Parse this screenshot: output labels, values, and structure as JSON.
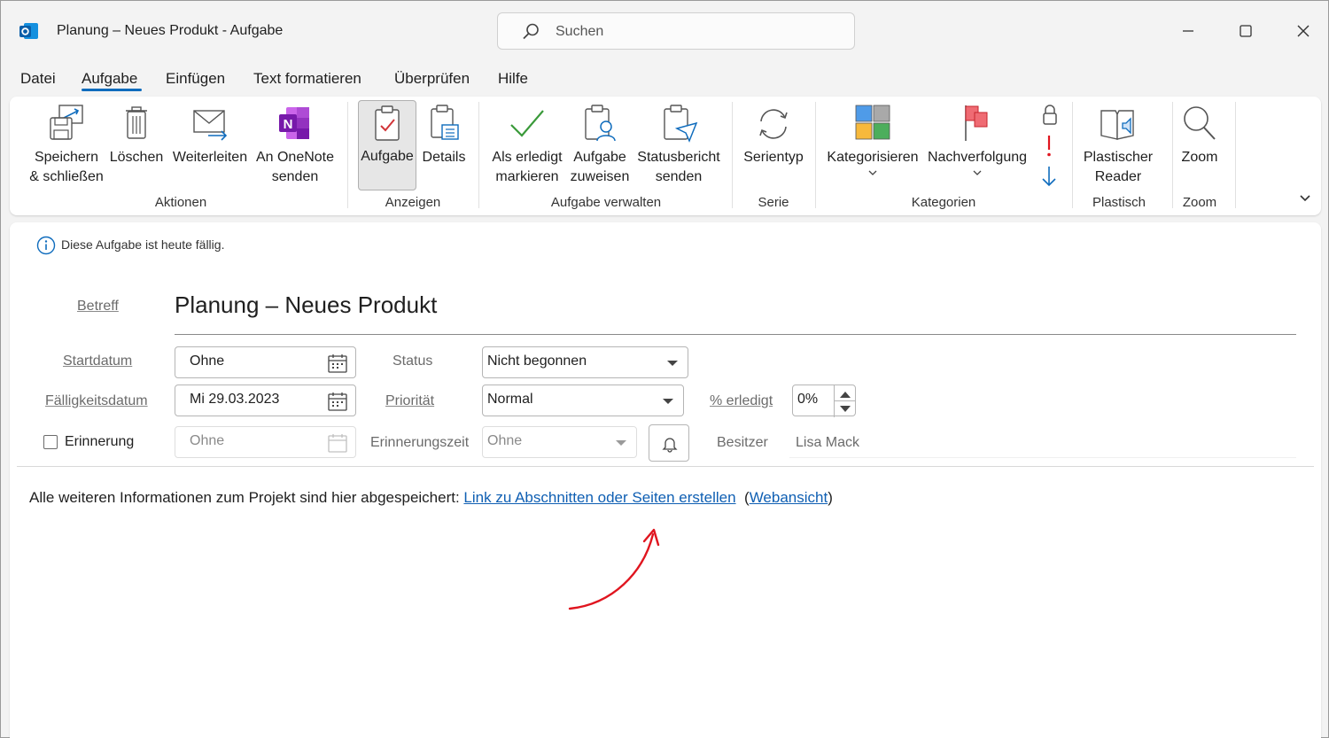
{
  "window": {
    "title": "Planung – Neues Produkt  -  Aufgabe",
    "search_placeholder": "Suchen"
  },
  "menu": {
    "tabs": [
      "Datei",
      "Aufgabe",
      "Einfügen",
      "Text formatieren",
      "Überprüfen",
      "Hilfe"
    ],
    "active": "Aufgabe"
  },
  "ribbon": {
    "save_close": [
      "Speichern",
      "& schließen"
    ],
    "delete": "Löschen",
    "forward": "Weiterleiten",
    "onenote": [
      "An OneNote",
      "senden"
    ],
    "group_actions": "Aktionen",
    "task": "Aufgabe",
    "details": "Details",
    "group_show": "Anzeigen",
    "mark_done": [
      "Als erledigt",
      "markieren"
    ],
    "assign": [
      "Aufgabe",
      "zuweisen"
    ],
    "status_report": [
      "Statusbericht",
      "senden"
    ],
    "group_manage": "Aufgabe verwalten",
    "recurrence": "Serientyp",
    "group_series": "Serie",
    "categorize": "Kategorisieren",
    "followup": "Nachverfolgung",
    "group_categories": "Kategorien",
    "reader": [
      "Plastischer",
      "Reader"
    ],
    "group_immersive": "Plastisch",
    "zoom": "Zoom",
    "group_zoom": "Zoom"
  },
  "form": {
    "info": "Diese Aufgabe ist heute fällig.",
    "subject_label": "Betreff",
    "subject": "Planung – Neues Produkt",
    "start_label": "Startdatum",
    "start_value": "Ohne",
    "due_label": "Fälligkeitsdatum",
    "due_value": "Mi 29.03.2023",
    "reminder_label": "Erinnerung",
    "reminder_date": "Ohne",
    "status_label": "Status",
    "status_value": "Nicht begonnen",
    "priority_label": "Priorität",
    "priority_value": "Normal",
    "reminder_time_label": "Erinnerungszeit",
    "reminder_time_value": "Ohne",
    "percent_label": "% erledigt",
    "percent_value": "0%",
    "owner_label": "Besitzer",
    "owner_value": "Lisa Mack"
  },
  "body": {
    "text": "Alle weiteren Informationen zum Projekt sind hier abgespeichert: ",
    "link": "Link zu Abschnitten oder Seiten erstellen",
    "open_paren": "(",
    "web_link": "Webansicht",
    "close_paren": ")"
  },
  "colors": {
    "accent": "#0f6cbd",
    "annotation_arrow": "#e0151f",
    "onenote": "#7719aa"
  }
}
